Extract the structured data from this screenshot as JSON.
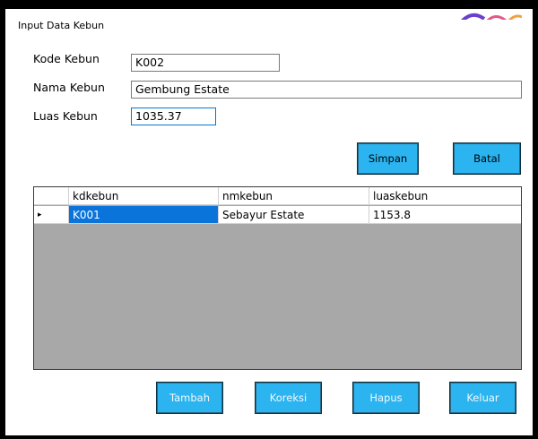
{
  "window": {
    "title": "Input Data Kebun"
  },
  "form": {
    "kode_label": "Kode Kebun",
    "kode_value": "K002",
    "nama_label": "Nama Kebun",
    "nama_value": "Gembung Estate",
    "luas_label": "Luas Kebun",
    "luas_value": "1035.37"
  },
  "actions": {
    "simpan_label": "Simpan",
    "batal_label": "Batal"
  },
  "grid": {
    "columns": [
      "kdkebun",
      "nmkebun",
      "luaskebun"
    ],
    "rows": [
      {
        "indicator": "▸",
        "kdkebun": "K001",
        "nmkebun": "Sebayur Estate",
        "luaskebun": "1153.8"
      }
    ]
  },
  "bottom_buttons": {
    "tambah_label": "Tambah",
    "koreksi_label": "Koreksi",
    "hapus_label": "Hapus",
    "keluar_label": "Keluar"
  },
  "colors": {
    "button_bg": "#2bb4f0",
    "selection": "#0a74da",
    "grid_empty": "#a8a8a8"
  }
}
